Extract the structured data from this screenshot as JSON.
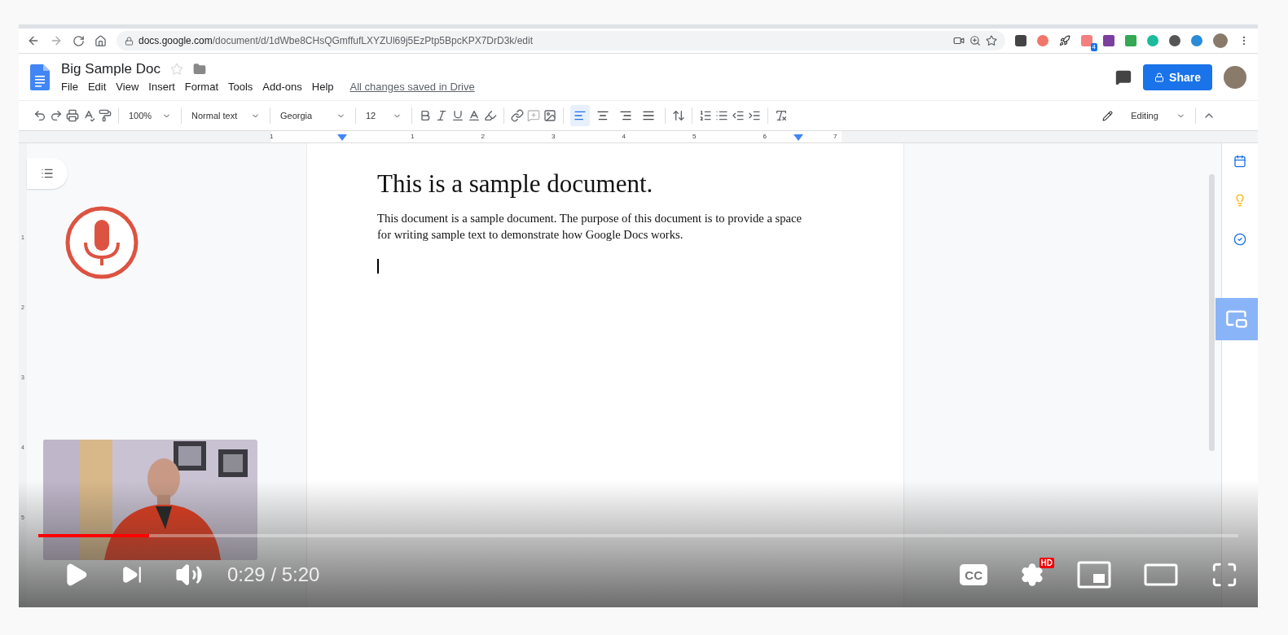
{
  "browser": {
    "url_host": "docs.google.com",
    "url_path": "/document/d/1dWbe8CHsQGmffufLXYZUl69j5EzPtp5BpcKPX7DrD3k/edit",
    "extension_badge": "4"
  },
  "doc_header": {
    "title": "Big Sample Doc",
    "starred": false,
    "menu": [
      "File",
      "Edit",
      "View",
      "Insert",
      "Format",
      "Tools",
      "Add-ons",
      "Help"
    ],
    "save_status": "All changes saved in Drive",
    "share_label": "Share"
  },
  "toolbar": {
    "zoom": "100%",
    "style": "Normal text",
    "font": "Georgia",
    "size": "12",
    "alignments": [
      {
        "kind": "left",
        "selected": true
      },
      {
        "kind": "center",
        "selected": false
      },
      {
        "kind": "right",
        "selected": false
      },
      {
        "kind": "justify",
        "selected": false
      }
    ],
    "mode": "Editing"
  },
  "ruler": {
    "labels": [
      "1",
      "1",
      "2",
      "3",
      "4",
      "5",
      "6",
      "7"
    ]
  },
  "vertical_ruler": {
    "labels": [
      "1",
      "2",
      "3",
      "4",
      "5"
    ]
  },
  "document": {
    "heading": "This is a sample document.",
    "paragraph": "This document is a sample document. The purpose of this document is to provide a space for writing sample text to demonstrate how Google Docs works."
  },
  "video_player": {
    "progress": {
      "level": 0.092
    },
    "time": "0:29 / 5:20",
    "captions_label": "CC",
    "quality_badge": "HD"
  }
}
